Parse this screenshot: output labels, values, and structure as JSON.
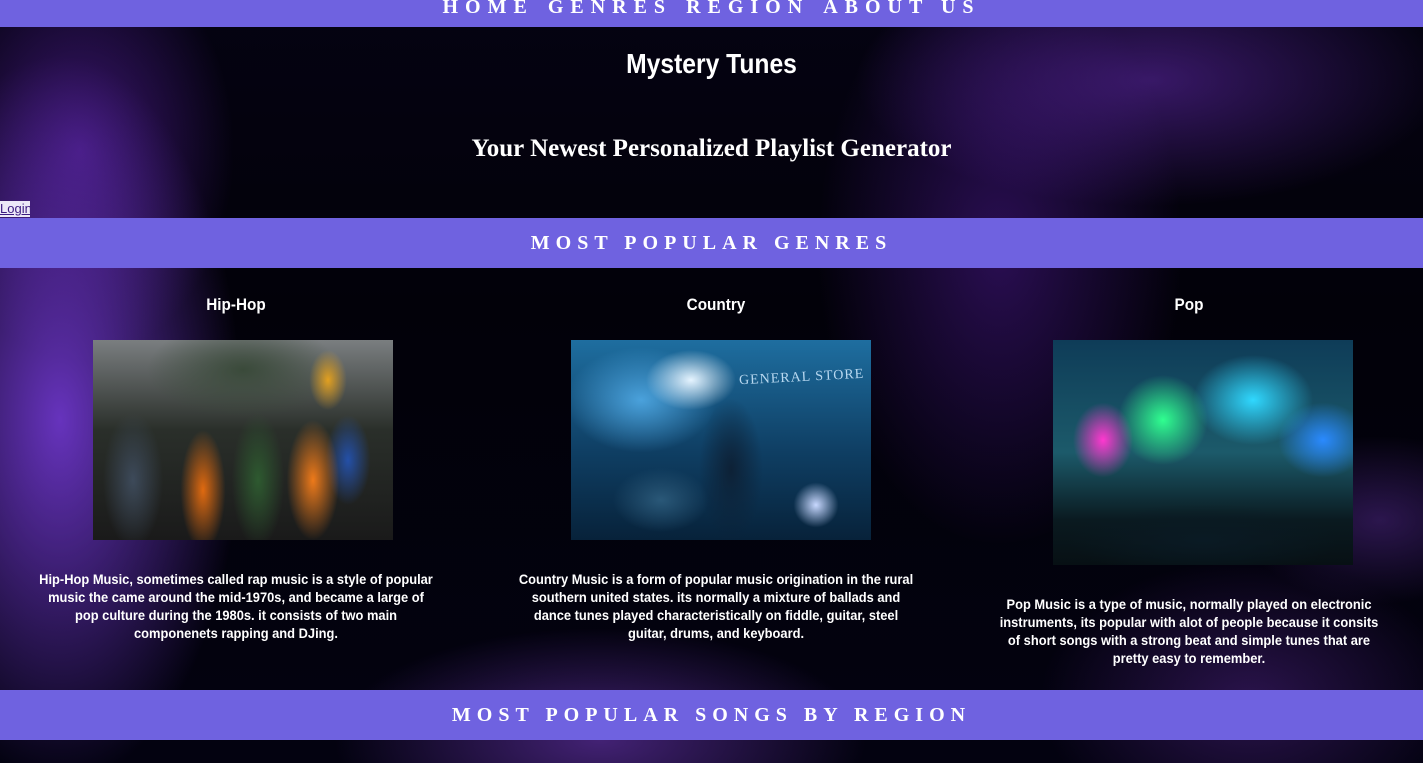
{
  "nav": {
    "items": [
      {
        "label": "HOME"
      },
      {
        "label": "GENRES"
      },
      {
        "label": "REGION"
      },
      {
        "label": "ABOUT US"
      }
    ]
  },
  "header": {
    "title": "Mystery Tunes",
    "tagline": "Your Newest Personalized Playlist Generator",
    "login_label": "Login"
  },
  "genres_section": {
    "heading": "MOST POPULAR GENRES",
    "genres": [
      {
        "name": "Hip-Hop",
        "image": "hip-hop group photo",
        "description": "Hip-Hop Music, sometimes called rap music is a style of popular music the came around the mid-1970s, and became a large of pop culture during the 1980s. it consists of two main componenets rapping and DJing."
      },
      {
        "name": "Country",
        "image": "country singer on stage",
        "image_sign_text": "GENERAL STORE",
        "description": "Country Music is a form of popular music origination in the rural southern united states. its normally a mixture of ballads and dance tunes played characteristically on fiddle, guitar, steel guitar, drums, and keyboard."
      },
      {
        "name": "Pop",
        "image": "pop concert crowd with colorful lights",
        "description": "Pop Music is a type of music, normally played on electronic instruments, its popular with alot of people because it consits of short songs with a strong beat and simple tunes that are pretty easy to remember."
      }
    ]
  },
  "region_section": {
    "heading": "MOST POPULAR SONGS BY REGION"
  },
  "colors": {
    "banner": "#6f62e0",
    "background": "#030210",
    "text": "#ffffff"
  }
}
